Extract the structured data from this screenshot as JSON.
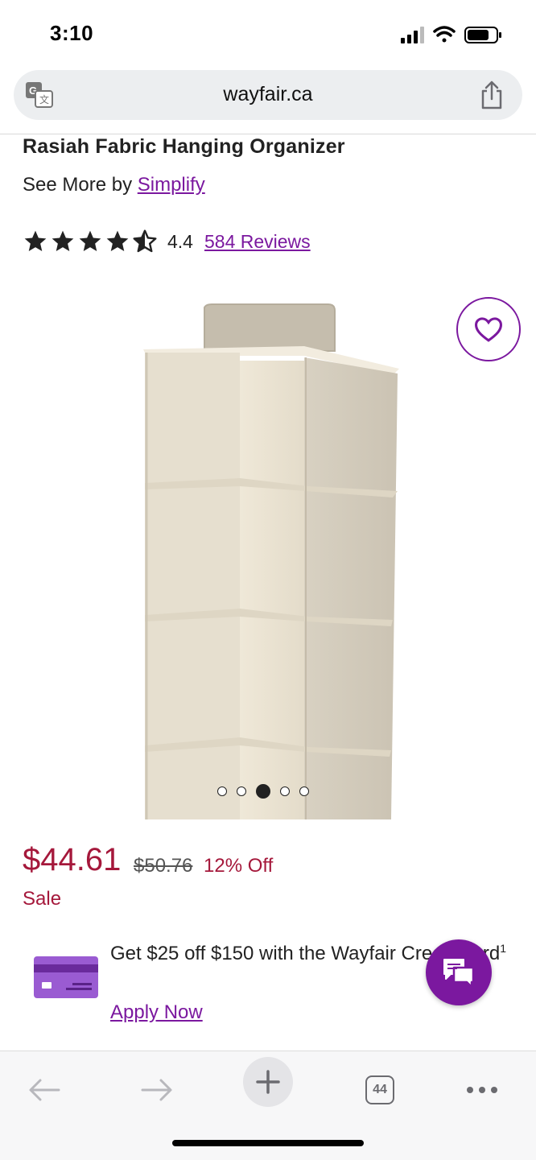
{
  "status_bar": {
    "time": "3:10"
  },
  "browser": {
    "url": "wayfair.ca",
    "tab_count": "44"
  },
  "product": {
    "title": "Rasiah Fabric Hanging Organizer",
    "see_more_prefix": "See More by",
    "brand": "Simplify",
    "rating": "4.4",
    "rating_value": 4.4,
    "rating_max": 5,
    "reviews_label": "584 Reviews",
    "image_count": 5,
    "active_image_index": 2
  },
  "pricing": {
    "price": "$44.61",
    "original_price": "$50.76",
    "discount": "12% Off",
    "sale_label": "Sale"
  },
  "promo": {
    "text": "Get $25 off $150 with the Wayfair Credit Card",
    "footnote": "1",
    "cta": "Apply Now"
  },
  "colors": {
    "brand_purple": "#7b189f",
    "price_red": "#a5183b",
    "card_purple": "#8a4cc4"
  },
  "icons": [
    "translate-icon",
    "share-icon",
    "heart-icon",
    "credit-card-icon",
    "chat-icon",
    "back-arrow-icon",
    "forward-arrow-icon",
    "plus-icon",
    "tabs-icon",
    "more-icon"
  ]
}
